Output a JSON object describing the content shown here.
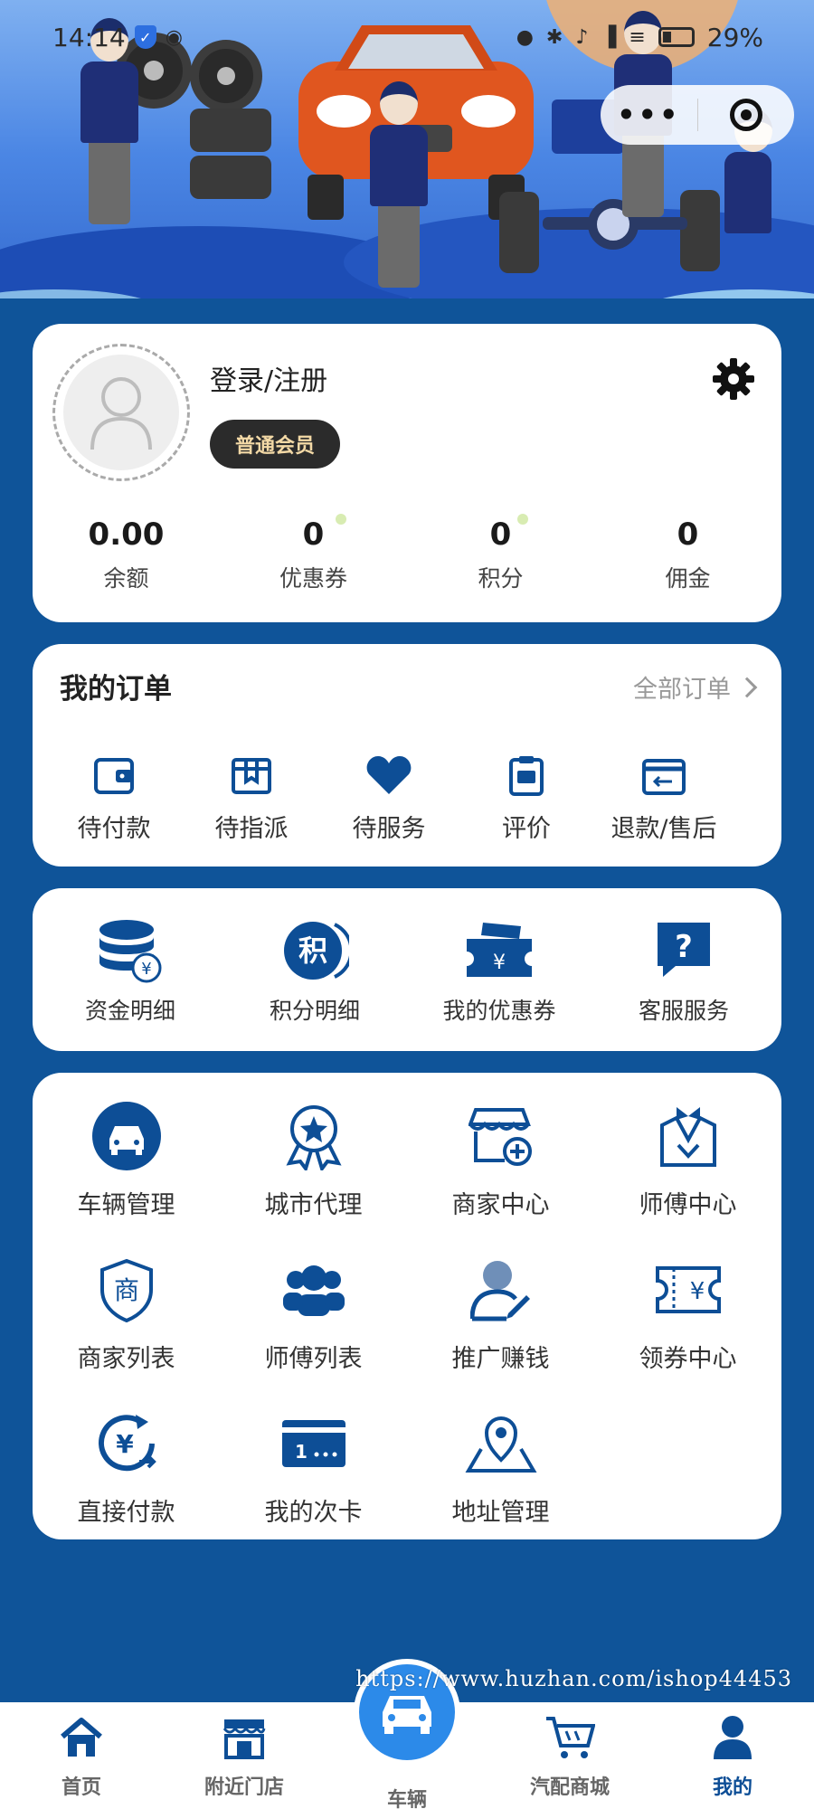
{
  "status_bar": {
    "time": "14:14",
    "battery": "29%"
  },
  "capsule": {
    "more_icon": "more-dots-icon",
    "close_icon": "target-icon"
  },
  "profile": {
    "login_label": "登录/注册",
    "member_badge": "普通会员",
    "stats": [
      {
        "value": "0.00",
        "label": "余额"
      },
      {
        "value": "0",
        "label": "优惠券"
      },
      {
        "value": "0",
        "label": "积分"
      },
      {
        "value": "0",
        "label": "佣金"
      }
    ]
  },
  "orders": {
    "title": "我的订单",
    "all_label": "全部订单",
    "items": [
      {
        "label": "待付款",
        "icon": "wallet-icon"
      },
      {
        "label": "待指派",
        "icon": "box-icon"
      },
      {
        "label": "待服务",
        "icon": "heart-icon"
      },
      {
        "label": "评价",
        "icon": "clipboard-icon"
      },
      {
        "label": "退款/售后",
        "icon": "refund-icon"
      }
    ]
  },
  "finance": {
    "items": [
      {
        "label": "资金明细",
        "icon": "coins-icon"
      },
      {
        "label": "积分明细",
        "icon": "points-icon"
      },
      {
        "label": "我的优惠券",
        "icon": "coupon-icon"
      },
      {
        "label": "客服服务",
        "icon": "help-icon"
      }
    ]
  },
  "services": {
    "items": [
      {
        "label": "车辆管理",
        "icon": "car-icon"
      },
      {
        "label": "城市代理",
        "icon": "award-icon"
      },
      {
        "label": "商家中心",
        "icon": "shop-add-icon"
      },
      {
        "label": "师傅中心",
        "icon": "worker-icon"
      },
      {
        "label": "商家列表",
        "icon": "merchant-shield-icon"
      },
      {
        "label": "师傅列表",
        "icon": "group-icon"
      },
      {
        "label": "推广赚钱",
        "icon": "promote-icon"
      },
      {
        "label": "领券中心",
        "icon": "ticket-icon"
      },
      {
        "label": "直接付款",
        "icon": "pay-icon"
      },
      {
        "label": "我的次卡",
        "icon": "card-icon"
      },
      {
        "label": "地址管理",
        "icon": "map-pin-icon"
      }
    ]
  },
  "watermark": "https://www.huzhan.com/ishop44453",
  "bottom_nav": [
    {
      "label": "首页",
      "icon": "home-icon"
    },
    {
      "label": "附近门店",
      "icon": "store-icon"
    },
    {
      "label": "车辆",
      "icon": "car-icon"
    },
    {
      "label": "汽配商城",
      "icon": "cart-icon"
    },
    {
      "label": "我的",
      "icon": "user-icon"
    }
  ],
  "colors": {
    "primary": "#0f5499",
    "accent": "#2c8ae9",
    "badge_text": "#f3d9a6"
  }
}
